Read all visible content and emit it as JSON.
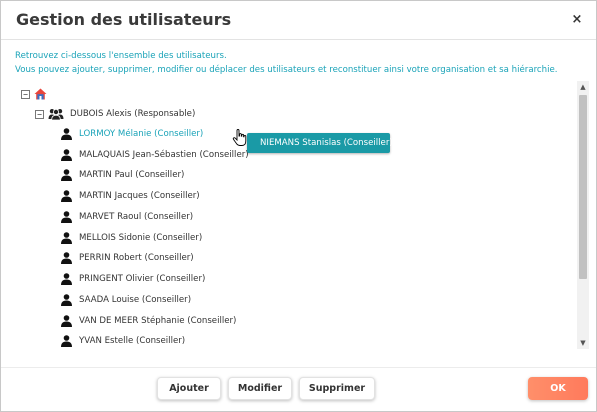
{
  "dialog": {
    "title": "Gestion des utilisateurs",
    "close_label": "×"
  },
  "intro": {
    "line1": "Retrouvez ci-dessous l'ensemble des utilisateurs.",
    "line2": "Vous pouvez ajouter, supprimer, modifier ou déplacer des utilisateurs et reconstituer ainsi votre organisation et sa hiérarchie."
  },
  "tree": {
    "root": {
      "toggle": "⊟",
      "icon": "home-icon"
    },
    "group": {
      "toggle": "⊟",
      "icon": "group-icon",
      "label": "DUBOIS Alexis (Responsable)"
    },
    "users": [
      {
        "label": "LORMOY Mélanie (Conseiller)",
        "selected": true
      },
      {
        "label": "MALAQUAIS Jean-Sébastien (Conseiller)"
      },
      {
        "label": "MARTIN Paul (Conseiller)"
      },
      {
        "label": "MARTIN Jacques (Conseiller)"
      },
      {
        "label": "MARVET Raoul (Conseiller)"
      },
      {
        "label": "MELLOIS Sidonie (Conseiller)"
      },
      {
        "label": "PERRIN Robert (Conseiller)"
      },
      {
        "label": "PRINGENT Olivier (Conseiller)"
      },
      {
        "label": "SAADA Louise (Conseiller)"
      },
      {
        "label": "VAN DE MEER Stéphanie (Conseiller)"
      },
      {
        "label": "YVAN Estelle (Conseiller)"
      }
    ]
  },
  "drag": {
    "label": "NIEMANS Stanislas (Conseiller)"
  },
  "scrollbar": {
    "up": "▲",
    "down": "▼"
  },
  "buttons": {
    "add": "Ajouter",
    "edit": "Modifier",
    "delete": "Supprimer",
    "ok": "OK"
  },
  "colors": {
    "accent": "#1aa3b8",
    "drag_bg": "#1a9aa6",
    "ok_bg": "#ff8566",
    "home_roof": "#e8453c",
    "home_body": "#3a6fc4"
  }
}
